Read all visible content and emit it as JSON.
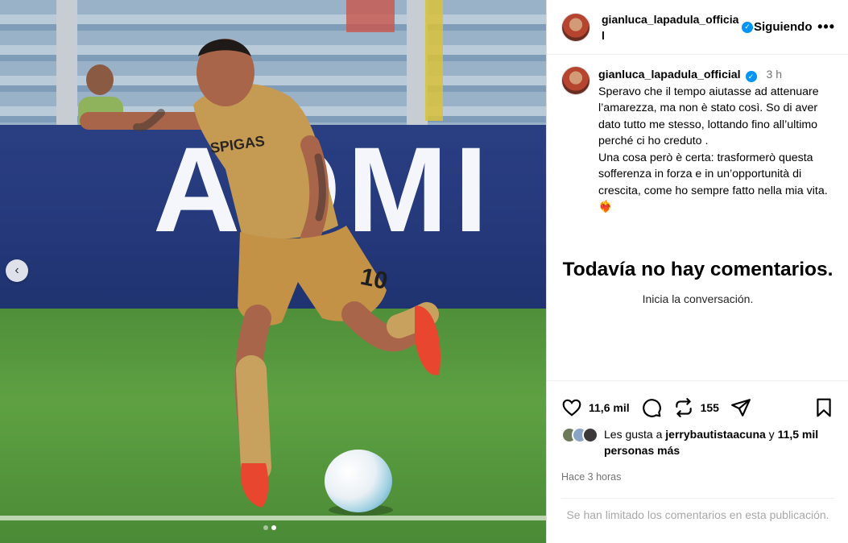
{
  "header": {
    "username": "gianluca_lapadula_official",
    "follow_label": "Siguiendo",
    "more_label": "•••"
  },
  "caption": {
    "username": "gianluca_lapadula_official",
    "time": "3 h",
    "text": "Speravo che il tempo aiutasse ad attenuare l’amarezza, ma non è stato così. So di aver dato tutto me stesso, lottando fino all’ultimo perché ci ho creduto .\nUna cosa però è certa: trasformerò questa sofferenza in forza e in un’opportunità di crescita, come ho sempre fatto nella mia vita. ",
    "emoji": "❤‍🔥"
  },
  "comments": {
    "empty_title": "Todavía no hay comentarios.",
    "empty_subtitle": "Inicia la conversación."
  },
  "actions": {
    "like_count": "11,6 mil",
    "repost_count": "155"
  },
  "likes": {
    "prefix": "Les gusta a ",
    "user": "jerrybautistaacuna",
    "connector": " y ",
    "others": "11,5 mil personas más"
  },
  "time_ago": "Hace 3 horas",
  "limited_notice": "Se han limitado los comentarios en esta publicación.",
  "media": {
    "banner_text": "AOMI",
    "jersey_number": "10",
    "slide_index": 2,
    "slide_total": 2
  },
  "icons": {
    "verified": "verified-badge-icon",
    "like": "heart-icon",
    "comment": "comment-bubble-icon",
    "repost": "repost-icon",
    "share": "paper-plane-icon",
    "save": "bookmark-icon",
    "prev": "chevron-left-icon"
  },
  "colors": {
    "verified": "#0095f6",
    "muted": "#737373",
    "border": "#dbdbdb"
  }
}
